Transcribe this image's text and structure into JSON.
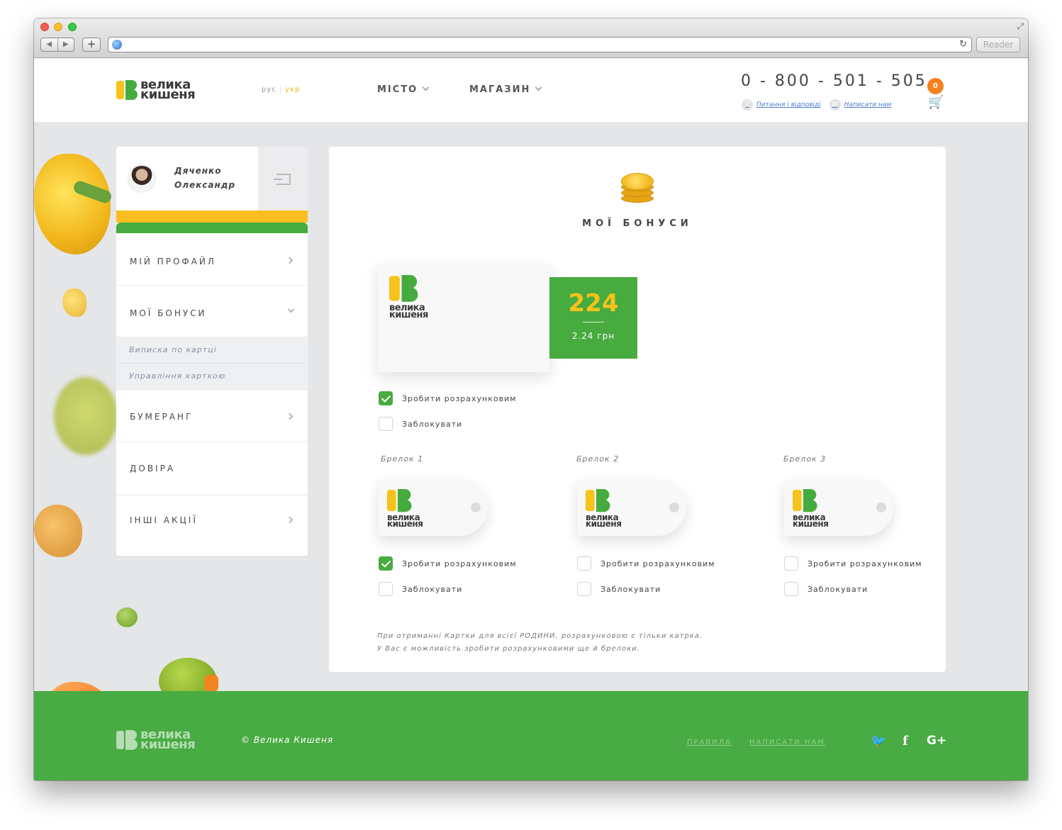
{
  "browser": {
    "reader_label": "Reader",
    "url": ""
  },
  "header": {
    "brand": {
      "line1": "велика",
      "line2": "кишеня"
    },
    "lang": {
      "ru": "рус",
      "uk": "укр"
    },
    "menu": [
      {
        "label": "МІСТО"
      },
      {
        "label": "МАГАЗИН"
      }
    ],
    "phone": "0 - 800 - 501 - 505",
    "links": {
      "faq": "Питання і відповіді",
      "contact": "Написати нам"
    },
    "cart_count": "0"
  },
  "sidebar": {
    "user_name": "Дяченко Олександр",
    "items": [
      {
        "label": "МІЙ ПРОФАЙЛ"
      },
      {
        "label": "МОЇ БОНУСИ"
      },
      {
        "label": "БУМЕРАНГ"
      },
      {
        "label": "ДОВІРА"
      },
      {
        "label": "ІНШІ АКЦІЇ"
      }
    ],
    "subitems": [
      {
        "label": "Виписка по картці"
      },
      {
        "label": "Управління карткою"
      }
    ]
  },
  "main": {
    "title": "МОЇ БОНУСИ",
    "card": {
      "brand_line1": "велика",
      "brand_line2": "кишеня",
      "bonus_points": "224",
      "bonus_uah": "2.24 грн",
      "options": [
        {
          "label": "Зробити розрахунковим",
          "checked": true
        },
        {
          "label": "Заблокувати",
          "checked": false
        }
      ]
    },
    "fobs": [
      {
        "label": "Брелок 1",
        "brand_line1": "велика",
        "brand_line2": "кишеня",
        "options": [
          {
            "label": "Зробити розрахунковим",
            "checked": true
          },
          {
            "label": "Заблокувати",
            "checked": false
          }
        ]
      },
      {
        "label": "Брелок 2",
        "brand_line1": "велика",
        "brand_line2": "кишеня",
        "options": [
          {
            "label": "Зробити розрахунковим",
            "checked": false
          },
          {
            "label": "Заблокувати",
            "checked": false
          }
        ]
      },
      {
        "label": "Брелок 3",
        "brand_line1": "велика",
        "brand_line2": "кишеня",
        "options": [
          {
            "label": "Зробити розрахунковим",
            "checked": false
          },
          {
            "label": "Заблокувати",
            "checked": false
          }
        ]
      }
    ],
    "note_line1": "При отриманні Картки для всієї РОДИНИ, розрахунковою є тільки катрка.",
    "note_line2": "У Вас є можливість зробити розрахунковими ще й брелоки."
  },
  "footer": {
    "brand": {
      "line1": "велика",
      "line2": "кишеня"
    },
    "copyright": "© Велика Кишеня",
    "links": [
      {
        "label": "ПРАВИЛА"
      },
      {
        "label": "НАПИСАТИ НАМ"
      }
    ],
    "social": [
      {
        "icon": "twitter-icon",
        "glyph": "🐦"
      },
      {
        "icon": "facebook-icon",
        "glyph": "f"
      },
      {
        "icon": "google-plus-icon",
        "glyph": "G+"
      }
    ]
  },
  "colors": {
    "brand_green": "#47ab3f",
    "brand_yellow": "#f7c21b",
    "cart_orange": "#f5811f"
  }
}
